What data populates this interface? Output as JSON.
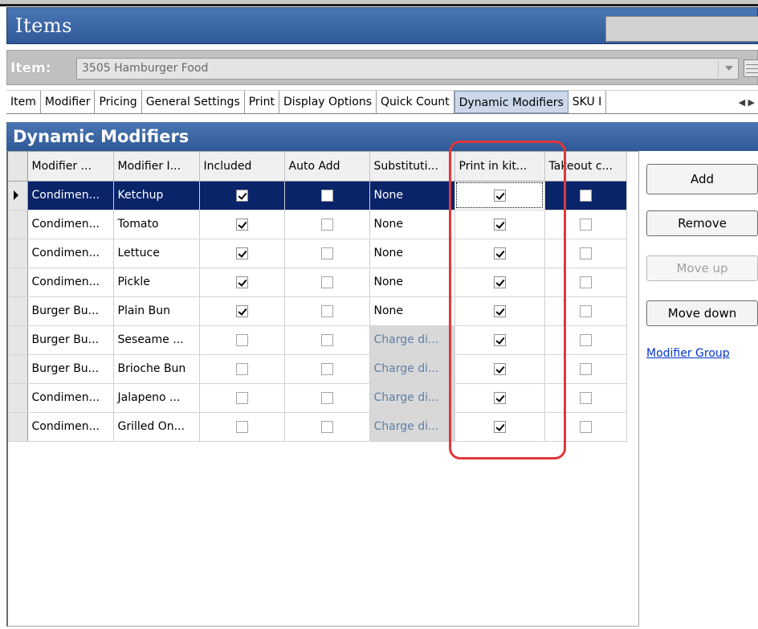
{
  "window": {
    "title": "Items"
  },
  "item_selector": {
    "label": "Item:",
    "value": "3505 Hamburger Food"
  },
  "tabs": [
    {
      "label": "Item",
      "active": false
    },
    {
      "label": "Modifier",
      "active": false
    },
    {
      "label": "Pricing",
      "active": false
    },
    {
      "label": "General Settings",
      "active": false
    },
    {
      "label": "Print",
      "active": false
    },
    {
      "label": "Display Options",
      "active": false
    },
    {
      "label": "Quick Count",
      "active": false
    },
    {
      "label": "Dynamic Modifiers",
      "active": true
    },
    {
      "label": "SKU I",
      "active": false
    }
  ],
  "section": {
    "title": "Dynamic Modifiers"
  },
  "grid": {
    "columns": [
      "Modifier ...",
      "Modifier I...",
      "Included",
      "Auto Add",
      "Substituti...",
      "Print in kit...",
      "Takeout c..."
    ],
    "rows": [
      {
        "group": "Condimen...",
        "item": "Ketchup",
        "included": true,
        "auto_add": false,
        "substitution": "None",
        "print_in_kitchen": true,
        "takeout": false,
        "selected": true
      },
      {
        "group": "Condimen...",
        "item": "Tomato",
        "included": true,
        "auto_add": false,
        "substitution": "None",
        "print_in_kitchen": true,
        "takeout": false
      },
      {
        "group": "Condimen...",
        "item": "Lettuce",
        "included": true,
        "auto_add": false,
        "substitution": "None",
        "print_in_kitchen": true,
        "takeout": false
      },
      {
        "group": "Condimen...",
        "item": "Pickle",
        "included": true,
        "auto_add": false,
        "substitution": "None",
        "print_in_kitchen": true,
        "takeout": false
      },
      {
        "group": "Burger Bu...",
        "item": "Plain Bun",
        "included": true,
        "auto_add": false,
        "substitution": "None",
        "print_in_kitchen": true,
        "takeout": false
      },
      {
        "group": "Burger Bu...",
        "item": "Seseame ...",
        "included": false,
        "auto_add": false,
        "substitution": "Charge di...",
        "print_in_kitchen": true,
        "takeout": false
      },
      {
        "group": "Burger Bu...",
        "item": "Brioche Bun",
        "included": false,
        "auto_add": false,
        "substitution": "Charge di...",
        "print_in_kitchen": true,
        "takeout": false
      },
      {
        "group": "Condimen...",
        "item": "Jalapeno ...",
        "included": false,
        "auto_add": false,
        "substitution": "Charge di...",
        "print_in_kitchen": true,
        "takeout": false
      },
      {
        "group": "Condimen...",
        "item": "Grilled On...",
        "included": false,
        "auto_add": false,
        "substitution": "Charge di...",
        "print_in_kitchen": true,
        "takeout": false
      }
    ]
  },
  "buttons": {
    "add": "Add",
    "remove": "Remove",
    "move_up": "Move up",
    "move_down": "Move down"
  },
  "links": {
    "modifier_group": "Modifier Group"
  },
  "colors": {
    "header_blue": "#2f5a98",
    "selection_navy": "#0a246a",
    "highlight_red": "#e0383b",
    "link_blue": "#0033cc"
  }
}
